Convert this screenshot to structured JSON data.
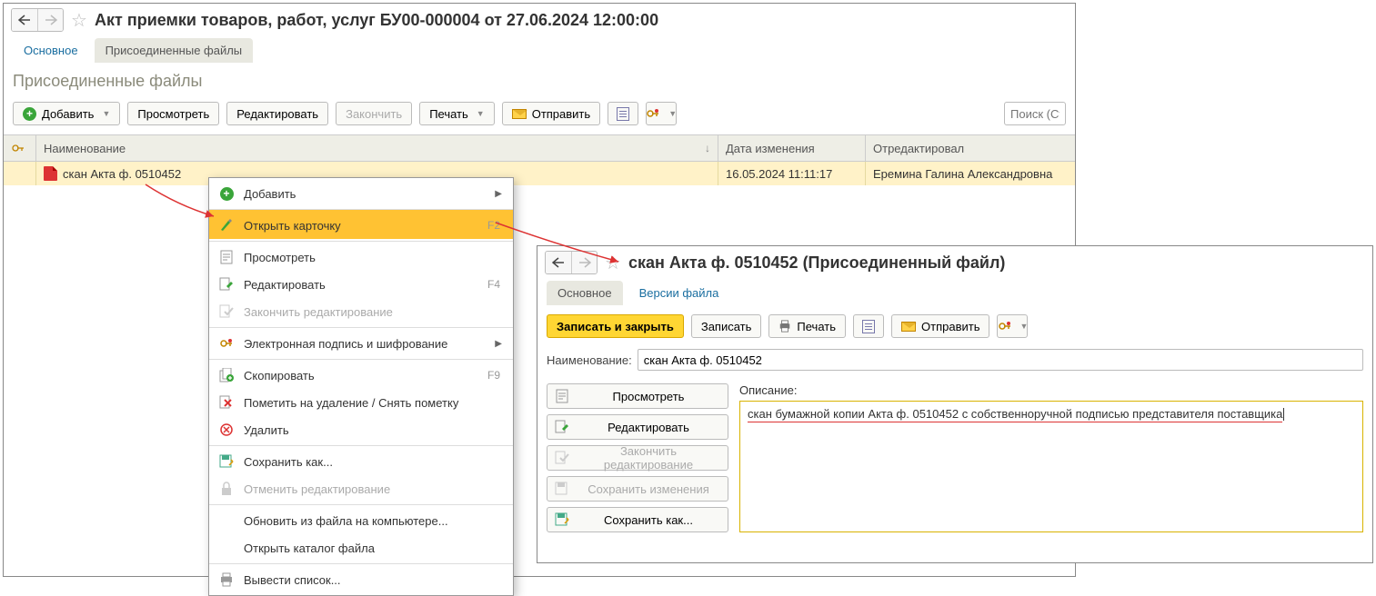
{
  "win1": {
    "title": "Акт приемки товаров, работ, услуг БУ00-000004 от 27.06.2024 12:00:00",
    "tabs": {
      "main": "Основное",
      "attached": "Присоединенные файлы"
    },
    "subheading": "Присоединенные файлы",
    "toolbar": {
      "add": "Добавить",
      "view": "Просмотреть",
      "edit": "Редактировать",
      "finish": "Закончить",
      "print": "Печать",
      "send": "Отправить",
      "search_placeholder": "Поиск (Ctrl"
    },
    "table": {
      "headers": {
        "name": "Наименование",
        "date": "Дата изменения",
        "editor": "Отредактировал"
      },
      "rows": [
        {
          "name": "скан Акта ф. 0510452",
          "date": "16.05.2024 11:11:17",
          "editor": "Еремина Галина Александровна"
        }
      ]
    }
  },
  "ctx": {
    "add": "Добавить",
    "open_card": "Открыть карточку",
    "open_card_sc": "F2",
    "view": "Просмотреть",
    "edit": "Редактировать",
    "edit_sc": "F4",
    "finish_edit": "Закончить редактирование",
    "sign": "Электронная подпись и шифрование",
    "copy": "Скопировать",
    "copy_sc": "F9",
    "mark_delete": "Пометить на удаление / Снять пометку",
    "delete": "Удалить",
    "save_as": "Сохранить как...",
    "cancel_edit": "Отменить редактирование",
    "update_from_file": "Обновить из файла на компьютере...",
    "open_dir": "Открыть каталог файла",
    "output_list": "Вывести список..."
  },
  "win2": {
    "title": "скан Акта ф. 0510452 (Присоединенный файл)",
    "tabs": {
      "main": "Основное",
      "versions": "Версии файла"
    },
    "toolbar": {
      "save_close": "Записать и закрыть",
      "save": "Записать",
      "print": "Печать",
      "send": "Отправить"
    },
    "name_label": "Наименование:",
    "name_value": "скан Акта ф. 0510452",
    "desc_label": "Описание:",
    "desc_value": "скан бумажной копии Акта ф. 0510452 с собственноручной подписью представителя поставщика",
    "actions": {
      "view": "Просмотреть",
      "edit": "Редактировать",
      "finish_edit": "Закончить редактирование",
      "save_changes": "Сохранить изменения",
      "save_as": "Сохранить как..."
    }
  }
}
